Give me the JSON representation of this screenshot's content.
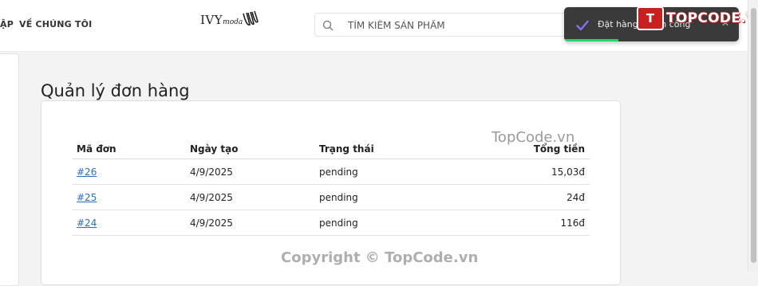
{
  "header": {
    "nav_partial": "ẬP",
    "nav_about": "VỀ CHÚNG TÔI",
    "logo_main": "IVY",
    "logo_sub": "moda",
    "search_placeholder": "TÌM KIẾM SẢN PHẨM"
  },
  "toast": {
    "message": "Đặt hàng thành công",
    "progress": 0.31
  },
  "badge": {
    "mark": "T",
    "text": "TOPCODE.VN"
  },
  "page": {
    "title": "Quản lý đơn hàng"
  },
  "orders": {
    "headers": [
      "Mã đơn",
      "Ngày tạo",
      "Trạng thái",
      "Tổng tiền"
    ],
    "rows": [
      {
        "id": "#26",
        "date": "4/9/2025",
        "status": "pending",
        "total": "15,03đ"
      },
      {
        "id": "#25",
        "date": "4/9/2025",
        "status": "pending",
        "total": "24đ"
      },
      {
        "id": "#24",
        "date": "4/9/2025",
        "status": "pending",
        "total": "116đ"
      }
    ]
  },
  "watermarks": {
    "mid": "TopCode.vn",
    "bottom": "Copyright © TopCode.vn"
  },
  "colors": {
    "link": "#2a6fbe",
    "toast_bg": "#3a3a3a",
    "toast_progress": "#1fd56a",
    "badge_red": "#c81f1f"
  },
  "icons": {
    "search": "search-icon",
    "check": "check-icon",
    "close": "close-icon"
  }
}
